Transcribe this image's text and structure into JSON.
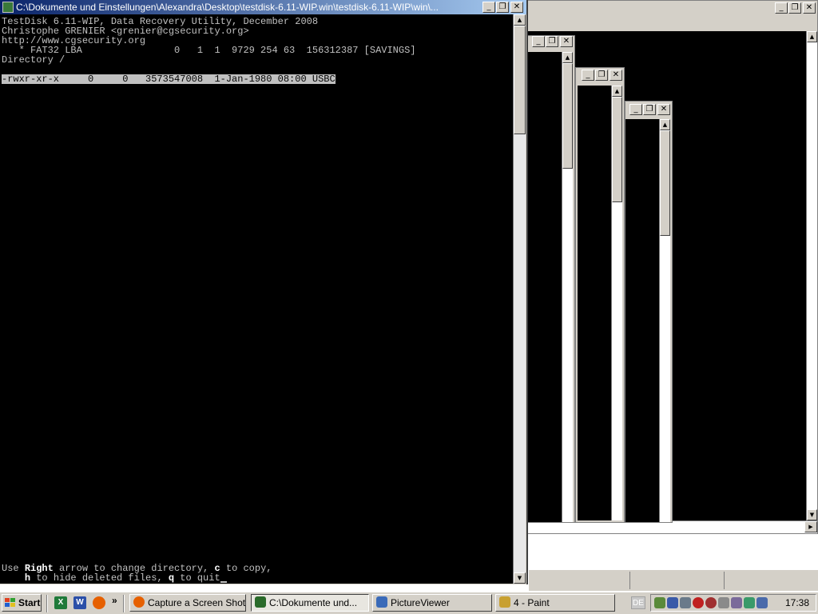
{
  "console_window": {
    "title": "C:\\Dokumente und Einstellungen\\Alexandra\\Desktop\\testdisk-6.11-WIP.win\\testdisk-6.11-WIP\\win\\...",
    "lines": {
      "l1": "TestDisk 6.11-WIP, Data Recovery Utility, December 2008",
      "l2": "Christophe GRENIER <grenier@cgsecurity.org>",
      "l3": "http://www.cgsecurity.org",
      "l4": "   * FAT32 LBA                0   1  1  9729 254 63  156312387 [SAVINGS]",
      "l5": "Directory /",
      "selected_entry": "-rwxr-xr-x     0     0   3573547008  1-Jan-1980 08:00 USBC"
    },
    "help": {
      "use": "Use ",
      "right": "Right",
      "rest1": " arrow to change directory, ",
      "c": "c",
      "rest2": " to copy,",
      "indent": "    ",
      "h": "h",
      "rest3": " to hide deleted files, ",
      "q": "q",
      "rest4": " to quit"
    }
  },
  "caption_buttons": {
    "minimize": "_",
    "restore": "❐",
    "close": "✕"
  },
  "taskbar": {
    "start_label": "Start",
    "quick_launch_more": "»",
    "tasks": [
      {
        "label": "Capture a Screen Shot ...",
        "icon": "firefox-icon",
        "color": "#e66000"
      },
      {
        "label": "C:\\Dokumente und...",
        "icon": "console-icon",
        "color": "#2a6a2a"
      },
      {
        "label": "PictureViewer",
        "icon": "pictureviewer-icon",
        "color": "#3a6ab8"
      },
      {
        "label": "4 - Paint",
        "icon": "paint-icon",
        "color": "#c8a030"
      }
    ],
    "language": "DE",
    "clock": "17:38"
  },
  "colors": {
    "title_active_start": "#0a246a",
    "title_active_end": "#a6caf0",
    "terminal_bg": "#000000",
    "terminal_fg": "#c0c0c0"
  }
}
